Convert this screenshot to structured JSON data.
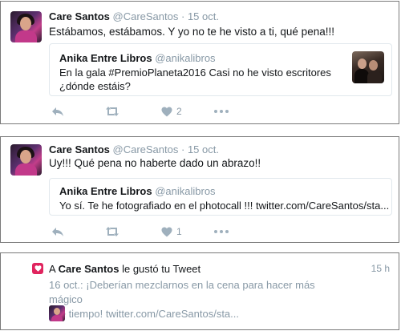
{
  "tweets": [
    {
      "author_name": "Care Santos",
      "author_handle": "@CareSantos",
      "separator": "·",
      "date": "15 oct.",
      "text": "Estábamos, estábamos. Y yo no te he visto a ti, qué pena!!!",
      "quote": {
        "author_name": "Anika Entre Libros",
        "author_handle": "@anikalibros",
        "text_line1": "En la gala #PremioPlaneta2016  Casi no he visto escritores",
        "text_line2": "¿dónde estáis?"
      },
      "like_count": "2"
    },
    {
      "author_name": "Care Santos",
      "author_handle": "@CareSantos",
      "separator": "·",
      "date": "15 oct.",
      "text": "Uy!!! Qué pena no haberte dado un abrazo!!",
      "quote": {
        "author_name": "Anika Entre Libros",
        "author_handle": "@anikalibros",
        "text_line1": "Yo sí. Te he fotografiado en el photocall !!! twitter.com/CareSantos/sta..."
      },
      "like_count": "1"
    }
  ],
  "notification": {
    "prefix": "A",
    "user_name": "Care Santos",
    "action": "le gustó tu Tweet",
    "time": "15 h",
    "tweet_line1": "16 oct.: ¡Deberían mezclarnos en la cena para hacer más mágico",
    "tweet_line2": "ese tiempo! twitter.com/CareSantos/sta..."
  },
  "colors": {
    "like_red": "#e0245e",
    "muted": "#8899a6",
    "icon": "#9fb0bd",
    "border": "#e1e8ed"
  },
  "icons": [
    "reply-icon",
    "retweet-icon",
    "heart-icon",
    "more-icon"
  ]
}
